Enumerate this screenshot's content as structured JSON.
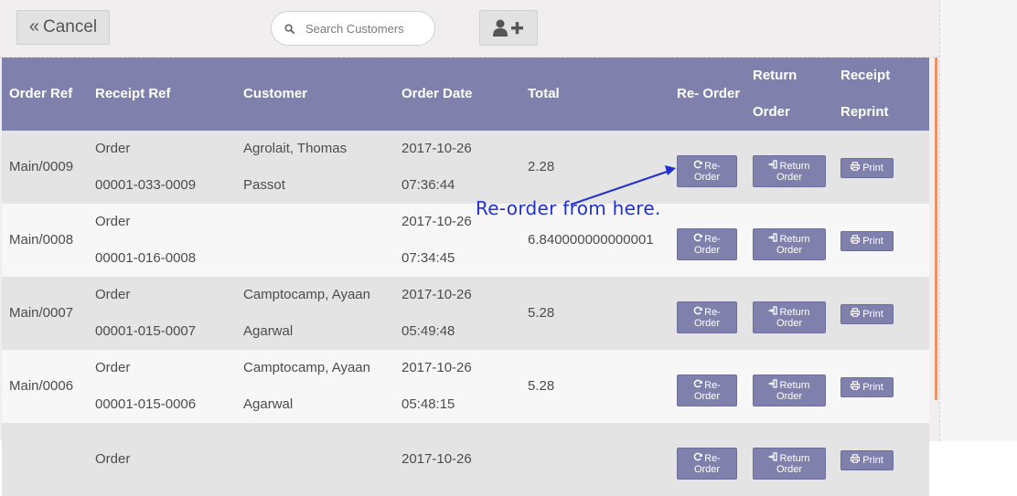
{
  "toolbar": {
    "cancel_label": "Cancel",
    "search_placeholder": "Search Customers"
  },
  "table": {
    "headers": {
      "order_ref": "Order Ref",
      "receipt_ref": "Receipt Ref",
      "customer": "Customer",
      "order_date": "Order Date",
      "total": "Total",
      "reorder_1": "Re-",
      "reorder_2": "Order",
      "return_1": "Return",
      "return_2": "Order",
      "receipt_1": "Receipt",
      "receipt_2": "Reprint"
    },
    "rows": [
      {
        "order_ref": "Main/0009",
        "receipt_1": "Order",
        "receipt_2": "00001-033-0009",
        "customer_1": "Agrolait, Thomas",
        "customer_2": "Passot",
        "date_1": "2017-10-26",
        "date_2": "07:36:44",
        "total": "2.28"
      },
      {
        "order_ref": "Main/0008",
        "receipt_1": "Order",
        "receipt_2": "00001-016-0008",
        "customer_1": "",
        "customer_2": "",
        "date_1": "2017-10-26",
        "date_2": "07:34:45",
        "total": "6.840000000000001"
      },
      {
        "order_ref": "Main/0007",
        "receipt_1": "Order",
        "receipt_2": "00001-015-0007",
        "customer_1": "Camptocamp, Ayaan",
        "customer_2": "Agarwal",
        "date_1": "2017-10-26",
        "date_2": "05:49:48",
        "total": "5.28"
      },
      {
        "order_ref": "Main/0006",
        "receipt_1": "Order",
        "receipt_2": "00001-015-0006",
        "customer_1": "Camptocamp, Ayaan",
        "customer_2": "Agarwal",
        "date_1": "2017-10-26",
        "date_2": "05:48:15",
        "total": "5.28"
      },
      {
        "order_ref": "",
        "receipt_1": "Order",
        "receipt_2": "",
        "customer_1": "",
        "customer_2": "",
        "date_1": "2017-10-26",
        "date_2": "",
        "total": ""
      }
    ],
    "buttons": {
      "reorder_1": "Re-",
      "reorder_2": "Order",
      "return_1": "Return",
      "return_2": "Order",
      "print": "Print"
    }
  },
  "annotation": {
    "text": "Re-order from here."
  },
  "icons": {
    "cancel": "double-chevron-left-icon",
    "search": "search-icon",
    "add_customer": "user-plus-icon",
    "reorder": "refresh-icon",
    "return": "sign-in-icon",
    "print": "print-icon"
  },
  "colors": {
    "header_bg": "#8080ad",
    "button_bg": "#8080ad",
    "row_odd": "#e4e4e4",
    "row_even": "#f7f7f7",
    "accent_bar": "#f0916a",
    "annotation": "#1f2fd1"
  }
}
